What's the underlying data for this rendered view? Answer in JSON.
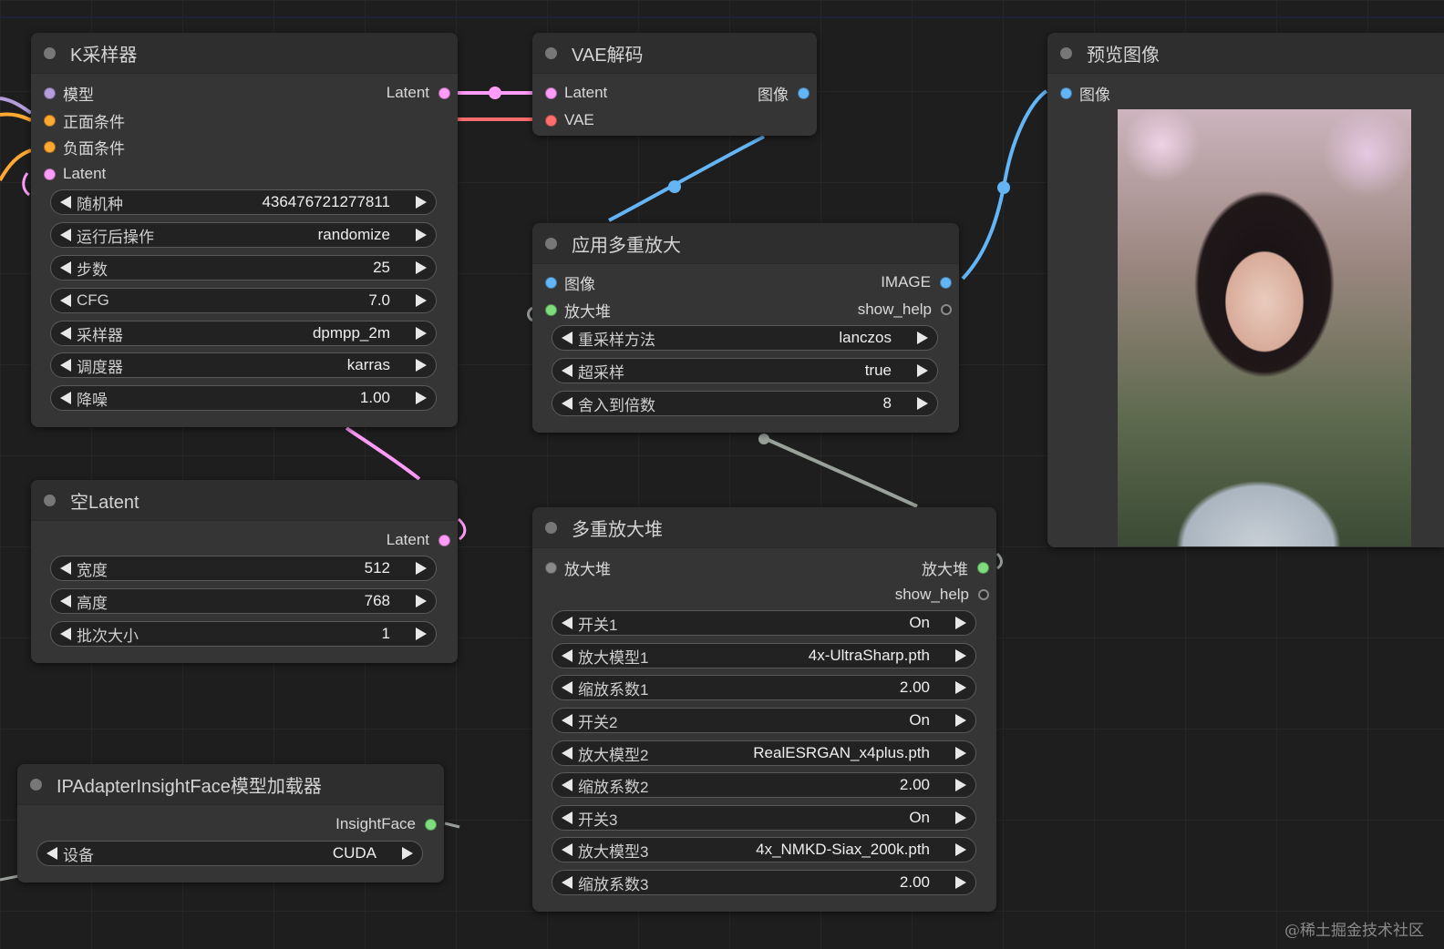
{
  "colors": {
    "model": "#b39ddb",
    "conditioning": "#ffa931",
    "latent": "#ff9cf9",
    "vae": "#ff6e6e",
    "image": "#64b5f6",
    "upscaler_stack": "#7ddc7b",
    "insightface": "#7ddc7b",
    "help": "#2a2a2a",
    "link_gray": "#9aa09a"
  },
  "ksampler": {
    "title": "K采样器",
    "inputs": [
      "模型",
      "正面条件",
      "负面条件",
      "Latent"
    ],
    "output": "Latent",
    "widgets": [
      {
        "label": "随机种",
        "value": "436476721277811"
      },
      {
        "label": "运行后操作",
        "value": "randomize"
      },
      {
        "label": "步数",
        "value": "25"
      },
      {
        "label": "CFG",
        "value": "7.0"
      },
      {
        "label": "采样器",
        "value": "dpmpp_2m"
      },
      {
        "label": "调度器",
        "value": "karras"
      },
      {
        "label": "降噪",
        "value": "1.00"
      }
    ]
  },
  "empty_latent": {
    "title": "空Latent",
    "output": "Latent",
    "widgets": [
      {
        "label": "宽度",
        "value": "512"
      },
      {
        "label": "高度",
        "value": "768"
      },
      {
        "label": "批次大小",
        "value": "1"
      }
    ]
  },
  "insightface_loader": {
    "title": "IPAdapterInsightFace模型加载器",
    "output": "InsightFace",
    "widgets": [
      {
        "label": "设备",
        "value": "CUDA"
      }
    ]
  },
  "vae_decode": {
    "title": "VAE解码",
    "inputs": [
      "Latent",
      "VAE"
    ],
    "output": "图像"
  },
  "apply_upscale": {
    "title": "应用多重放大",
    "inputs": [
      "图像",
      "放大堆"
    ],
    "outputs": [
      "IMAGE",
      "show_help"
    ],
    "widgets": [
      {
        "label": "重采样方法",
        "value": "lanczos"
      },
      {
        "label": "超采样",
        "value": "true"
      },
      {
        "label": "舍入到倍数",
        "value": "8"
      }
    ]
  },
  "upscale_stack": {
    "title": "多重放大堆",
    "input": "放大堆",
    "outputs": [
      "放大堆",
      "show_help"
    ],
    "widgets": [
      {
        "label": "开关1",
        "value": "On"
      },
      {
        "label": "放大模型1",
        "value": "4x-UltraSharp.pth"
      },
      {
        "label": "缩放系数1",
        "value": "2.00"
      },
      {
        "label": "开关2",
        "value": "On"
      },
      {
        "label": "放大模型2",
        "value": "RealESRGAN_x4plus.pth"
      },
      {
        "label": "缩放系数2",
        "value": "2.00"
      },
      {
        "label": "开关3",
        "value": "On"
      },
      {
        "label": "放大模型3",
        "value": "4x_NMKD-Siax_200k.pth"
      },
      {
        "label": "缩放系数3",
        "value": "2.00"
      }
    ]
  },
  "preview": {
    "title": "预览图像",
    "input": "图像"
  },
  "watermark": "@稀土掘金技术社区"
}
